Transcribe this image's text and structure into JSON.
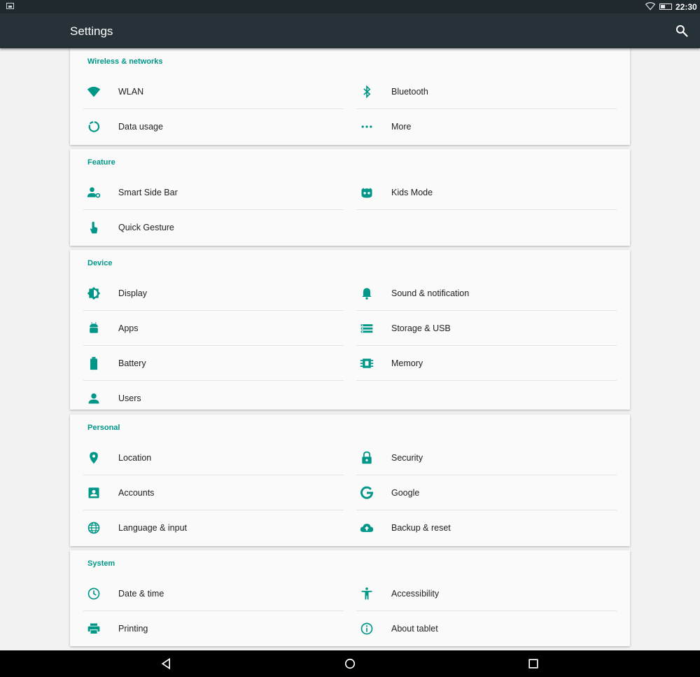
{
  "status_bar": {
    "time": "22:30"
  },
  "app_bar": {
    "title": "Settings"
  },
  "sections": [
    {
      "title": "Wireless & networks",
      "items": [
        {
          "label": "WLAN",
          "icon": "wifi-icon"
        },
        {
          "label": "Bluetooth",
          "icon": "bluetooth-icon"
        },
        {
          "label": "Data usage",
          "icon": "data-usage-icon"
        },
        {
          "label": "More",
          "icon": "more-icon"
        }
      ]
    },
    {
      "title": "Feature",
      "items": [
        {
          "label": "Smart Side Bar",
          "icon": "smart-side-bar-icon"
        },
        {
          "label": "Kids Mode",
          "icon": "kids-mode-icon"
        },
        {
          "label": "Quick Gesture",
          "icon": "gesture-icon"
        }
      ]
    },
    {
      "title": "Device",
      "items": [
        {
          "label": "Display",
          "icon": "display-icon"
        },
        {
          "label": "Sound & notification",
          "icon": "bell-icon"
        },
        {
          "label": "Apps",
          "icon": "android-icon"
        },
        {
          "label": "Storage & USB",
          "icon": "storage-icon"
        },
        {
          "label": "Battery",
          "icon": "battery-icon"
        },
        {
          "label": "Memory",
          "icon": "memory-icon"
        },
        {
          "label": "Users",
          "icon": "user-icon"
        }
      ]
    },
    {
      "title": "Personal",
      "items": [
        {
          "label": "Location",
          "icon": "location-icon"
        },
        {
          "label": "Security",
          "icon": "lock-icon"
        },
        {
          "label": "Accounts",
          "icon": "account-icon"
        },
        {
          "label": "Google",
          "icon": "google-icon"
        },
        {
          "label": "Language & input",
          "icon": "globe-icon"
        },
        {
          "label": "Backup & reset",
          "icon": "cloud-upload-icon"
        }
      ]
    },
    {
      "title": "System",
      "items": [
        {
          "label": "Date & time",
          "icon": "clock-icon"
        },
        {
          "label": "Accessibility",
          "icon": "accessibility-icon"
        },
        {
          "label": "Printing",
          "icon": "printer-icon"
        },
        {
          "label": "About tablet",
          "icon": "info-icon"
        }
      ]
    }
  ],
  "colors": {
    "accent": "#009688",
    "app_bar": "#263238",
    "status_bar": "#20292e",
    "background": "#f2f2f2",
    "card": "#fafafa"
  },
  "nav_bar": {
    "back_icon": "back-triangle-icon",
    "home_icon": "home-circle-icon",
    "recents_icon": "recents-square-icon"
  }
}
